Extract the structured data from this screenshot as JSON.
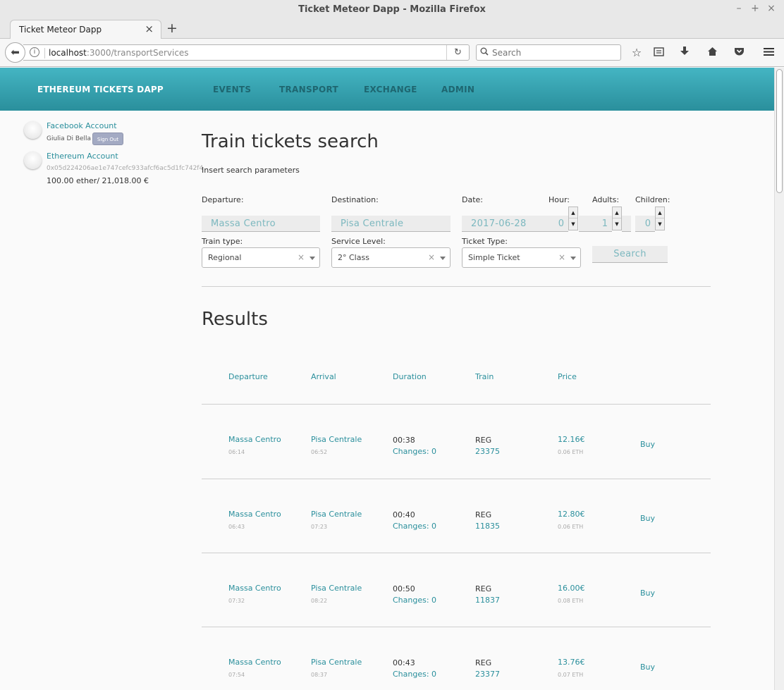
{
  "browser": {
    "window_title": "Ticket Meteor Dapp - Mozilla Firefox",
    "tab_title": "Ticket Meteor Dapp",
    "url_host": "localhost",
    "url_path": ":3000/transportServices",
    "search_placeholder": "Search"
  },
  "header": {
    "brand": "ETHEREUM TICKETS DAPP",
    "nav": [
      "EVENTS",
      "TRANSPORT",
      "EXCHANGE",
      "ADMIN"
    ]
  },
  "sidebar": {
    "facebook_label": "Facebook Account",
    "user_name": "Giulia Di Bella",
    "sign_out": "Sign Out",
    "ethereum_label": "Ethereum Account",
    "address": "0x05d224206ae1e747cefc933afcf6ac5d1fc742f4",
    "balance": "100.00 ether/ 21,018.00 €"
  },
  "search": {
    "title": "Train tickets search",
    "subtitle": "Insert search parameters",
    "labels": {
      "departure": "Departure:",
      "destination": "Destination:",
      "date": "Date:",
      "hour": "Hour:",
      "adults": "Adults:",
      "children": "Children:",
      "train_type": "Train type:",
      "service_level": "Service Level:",
      "ticket_type": "Ticket Type:"
    },
    "values": {
      "departure": "Massa Centro",
      "destination": "Pisa Centrale",
      "date": "2017-06-28",
      "hour": "0",
      "adults": "1",
      "children": "0",
      "train_type": "Regional",
      "service_level": "2° Class",
      "ticket_type": "Simple Ticket"
    },
    "button": "Search"
  },
  "results": {
    "title": "Results",
    "headers": [
      "Departure",
      "Arrival",
      "Duration",
      "Train",
      "Price"
    ],
    "buy_label": "Buy",
    "rows": [
      {
        "from": "Massa Centro",
        "dep_time": "06:14",
        "to": "Pisa Centrale",
        "arr_time": "06:52",
        "duration": "00:38",
        "changes": "Changes: 0",
        "train_type": "REG",
        "train_no": "23375",
        "price": "12.16€",
        "eth": "0.06 ETH"
      },
      {
        "from": "Massa Centro",
        "dep_time": "06:43",
        "to": "Pisa Centrale",
        "arr_time": "07:23",
        "duration": "00:40",
        "changes": "Changes: 0",
        "train_type": "REG",
        "train_no": "11835",
        "price": "12.80€",
        "eth": "0.06 ETH"
      },
      {
        "from": "Massa Centro",
        "dep_time": "07:32",
        "to": "Pisa Centrale",
        "arr_time": "08:22",
        "duration": "00:50",
        "changes": "Changes: 0",
        "train_type": "REG",
        "train_no": "11837",
        "price": "16.00€",
        "eth": "0.08 ETH"
      },
      {
        "from": "Massa Centro",
        "dep_time": "07:54",
        "to": "Pisa Centrale",
        "arr_time": "08:37",
        "duration": "00:43",
        "changes": "Changes: 0",
        "train_type": "REG",
        "train_no": "23377",
        "price": "13.76€",
        "eth": "0.07 ETH"
      }
    ]
  }
}
